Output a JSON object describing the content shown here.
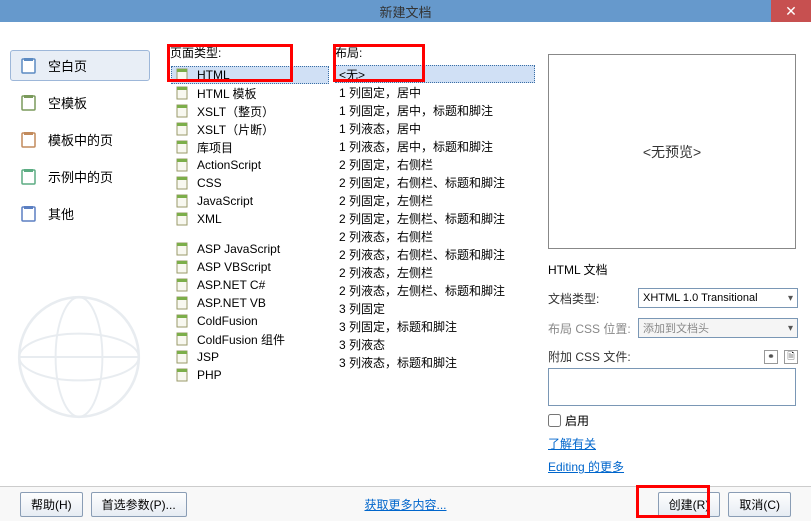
{
  "title": "新建文档",
  "close_label": "✕",
  "categories": [
    {
      "label": "空白页",
      "selected": true,
      "icon": "blank-page-icon"
    },
    {
      "label": "空模板",
      "selected": false,
      "icon": "blank-template-icon"
    },
    {
      "label": "模板中的页",
      "selected": false,
      "icon": "template-page-icon"
    },
    {
      "label": "示例中的页",
      "selected": false,
      "icon": "sample-page-icon"
    },
    {
      "label": "其他",
      "selected": false,
      "icon": "other-icon"
    }
  ],
  "col2_label": "页面类型:",
  "page_types_group1": [
    {
      "label": "HTML",
      "selected": true
    },
    {
      "label": "HTML 模板",
      "selected": false
    },
    {
      "label": "XSLT（整页）",
      "selected": false
    },
    {
      "label": "XSLT（片断）",
      "selected": false
    },
    {
      "label": "库项目",
      "selected": false
    },
    {
      "label": "ActionScript",
      "selected": false
    },
    {
      "label": "CSS",
      "selected": false
    },
    {
      "label": "JavaScript",
      "selected": false
    },
    {
      "label": "XML",
      "selected": false
    }
  ],
  "page_types_group2": [
    {
      "label": "ASP JavaScript",
      "selected": false
    },
    {
      "label": "ASP VBScript",
      "selected": false
    },
    {
      "label": "ASP.NET C#",
      "selected": false
    },
    {
      "label": "ASP.NET VB",
      "selected": false
    },
    {
      "label": "ColdFusion",
      "selected": false
    },
    {
      "label": "ColdFusion 组件",
      "selected": false
    },
    {
      "label": "JSP",
      "selected": false
    },
    {
      "label": "PHP",
      "selected": false
    }
  ],
  "col3_label": "布局:",
  "layouts": [
    {
      "label": "<无>",
      "selected": true
    },
    {
      "label": "1 列固定，居中",
      "selected": false
    },
    {
      "label": "1 列固定，居中，标题和脚注",
      "selected": false
    },
    {
      "label": "1 列液态，居中",
      "selected": false
    },
    {
      "label": "1 列液态，居中，标题和脚注",
      "selected": false
    },
    {
      "label": "2 列固定，右侧栏",
      "selected": false
    },
    {
      "label": "2 列固定，右侧栏、标题和脚注",
      "selected": false
    },
    {
      "label": "2 列固定，左侧栏",
      "selected": false
    },
    {
      "label": "2 列固定，左侧栏、标题和脚注",
      "selected": false
    },
    {
      "label": "2 列液态，右侧栏",
      "selected": false
    },
    {
      "label": "2 列液态，右侧栏、标题和脚注",
      "selected": false
    },
    {
      "label": "2 列液态，左侧栏",
      "selected": false
    },
    {
      "label": "2 列液态，左侧栏、标题和脚注",
      "selected": false
    },
    {
      "label": "3 列固定",
      "selected": false
    },
    {
      "label": "3 列固定，标题和脚注",
      "selected": false
    },
    {
      "label": "3 列液态",
      "selected": false
    },
    {
      "label": "3 列液态，标题和脚注",
      "selected": false
    }
  ],
  "preview_text": "<无预览>",
  "doc_type_text": "HTML 文档",
  "form": {
    "doc_type_label": "文档类型:",
    "doc_type_value": "XHTML 1.0 Transitional",
    "layout_css_label": "布局 CSS 位置:",
    "layout_css_value": "添加到文档头",
    "attach_css_label": "附加 CSS 文件:"
  },
  "enable_label": "启用",
  "link1": "了解有关",
  "link2": "Editing 的更多",
  "buttons": {
    "help": "帮助(H)",
    "prefs": "首选参数(P)...",
    "more": "获取更多内容...",
    "create": "创建(R)",
    "cancel": "取消(C)"
  }
}
